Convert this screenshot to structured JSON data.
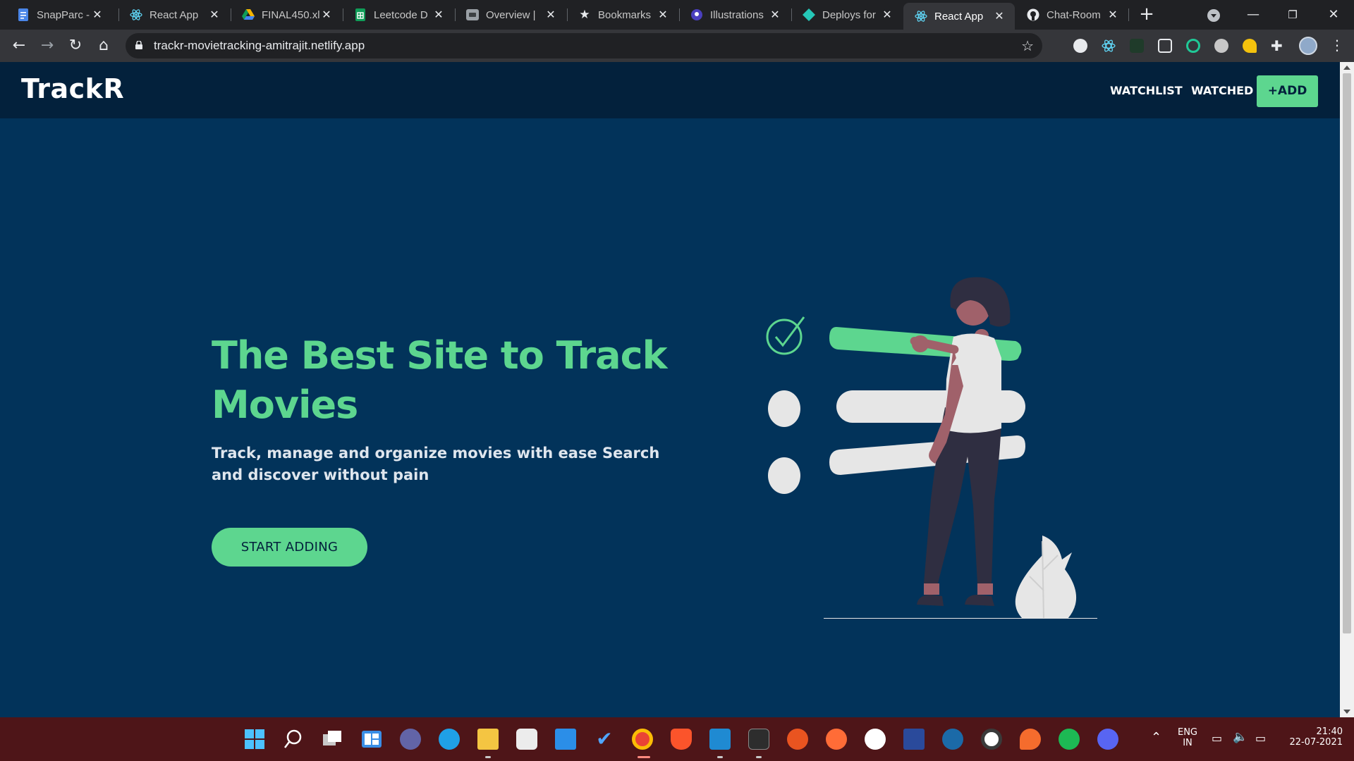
{
  "browser": {
    "tabs": [
      {
        "title": "SnapParc - ",
        "favicon": "docs-icon",
        "color": "#4a86e8",
        "active": false
      },
      {
        "title": "React App",
        "favicon": "react-icon",
        "color": "#61dafb",
        "active": false
      },
      {
        "title": "FINAL450.xl",
        "favicon": "drive-icon",
        "color": "#f4b400",
        "active": false
      },
      {
        "title": "Leetcode D",
        "favicon": "sheets-icon",
        "color": "#0f9d58",
        "active": false
      },
      {
        "title": "Overview |",
        "favicon": "overview-icon",
        "color": "#b0b0b0",
        "active": false
      },
      {
        "title": "Bookmarks",
        "favicon": "star-icon",
        "color": "#e8eaed",
        "active": false
      },
      {
        "title": "Illustrations",
        "favicon": "illustrations-icon",
        "color": "#6c63ff",
        "active": false
      },
      {
        "title": "Deploys for",
        "favicon": "netlify-icon",
        "color": "#25c7b7",
        "active": false
      },
      {
        "title": "React App",
        "favicon": "react-icon",
        "color": "#61dafb",
        "active": true
      },
      {
        "title": "Chat-Room",
        "favicon": "github-icon",
        "color": "#e8eaed",
        "active": false
      }
    ],
    "url": "trackr-movietracking-amitrajit.netlify.app"
  },
  "navbar": {
    "brand": "TrackR",
    "watchlist": "WATCHLIST",
    "watched": "WATCHED",
    "add": "+ADD"
  },
  "hero": {
    "title": "The Best Site to Track Movies",
    "subtitle": "Track, manage and organize movies with ease Search and discover without pain",
    "cta": "START ADDING"
  },
  "colors": {
    "background": "#02335a",
    "navbar": "#03213c",
    "accent": "#5dd68f"
  },
  "taskbar": {
    "icons": [
      "windows-start-icon",
      "search-icon",
      "task-view-icon",
      "widgets-icon",
      "teams-chat-icon",
      "edge-icon",
      "file-explorer-icon",
      "store-icon",
      "mail-icon",
      "todo-icon",
      "chrome-icon",
      "brave-icon",
      "vscode-icon",
      "terminal-icon",
      "ubuntu-icon",
      "postman-icon",
      "mongodb-icon",
      "dev-icon",
      "steam-icon",
      "obs-icon",
      "origin-icon",
      "spotify-icon",
      "discord-icon"
    ],
    "language": "ENG",
    "region": "IN",
    "time": "21:40",
    "date": "22-07-2021"
  }
}
